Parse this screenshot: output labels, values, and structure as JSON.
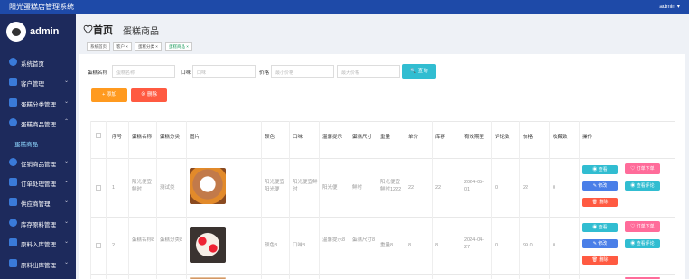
{
  "topbar": {
    "title": "阳光蛋糕店管理系统",
    "user": "admin ▾"
  },
  "sidebar": {
    "username": "admin",
    "items": [
      {
        "label": "系统首页",
        "arrow": ""
      },
      {
        "label": "客户管理",
        "arrow": "⌄"
      },
      {
        "label": "蛋糕分类管理",
        "arrow": "⌄"
      },
      {
        "label": "蛋糕商品管理",
        "arrow": "⌃"
      },
      {
        "label": "蛋糕商品",
        "arrow": ""
      },
      {
        "label": "促销商品管理",
        "arrow": "⌄"
      },
      {
        "label": "订单处理管理",
        "arrow": "⌄"
      },
      {
        "label": "供应商管理",
        "arrow": "⌄"
      },
      {
        "label": "库存原料管理",
        "arrow": "⌄"
      },
      {
        "label": "原料入库管理",
        "arrow": "⌄"
      },
      {
        "label": "原料出库管理",
        "arrow": "⌄"
      }
    ]
  },
  "header": {
    "home": "♡首页",
    "page": "蛋糕商品"
  },
  "crumbs": [
    "系统首页",
    "客户 ×",
    "蛋糕分类 ×",
    "蛋糕商品 ×"
  ],
  "search": {
    "name_label": "蛋糕名称",
    "name_placeholder": "蛋糕名称",
    "flavor_label": "口味",
    "flavor_placeholder": "口味",
    "price_label": "价格",
    "price_min_placeholder": "最小价格",
    "price_max_placeholder": "最大价格",
    "search_button": "🔍 查询"
  },
  "actions": {
    "add": "+ 添加",
    "delete": "⊗ 删除"
  },
  "table": {
    "headers": [
      "序号",
      "蛋糕名称",
      "蛋糕分类",
      "图片",
      "颜色",
      "口味",
      "温馨提示",
      "蛋糕尺寸",
      "重量",
      "单价",
      "库存",
      "有效期至",
      "评论数",
      "价格",
      "收藏数",
      "操作"
    ],
    "rows": [
      {
        "index": "1",
        "name": "阳光便宜鲜时",
        "category": "测试类",
        "color": "阳光便宜阳光便",
        "flavor": "阳光便宜鲜时",
        "tip": "阳光便",
        "size": "鲜时",
        "weight": "阳光便宜鲜时1222",
        "unit_price": "22",
        "stock": "22",
        "expiry": "2024-05-01",
        "comments": "0",
        "price": "22",
        "favorites": "0"
      },
      {
        "index": "2",
        "name": "蛋糕名称8",
        "category": "蛋糕分类8",
        "color": "颜色8",
        "flavor": "口味8",
        "tip": "温馨提示8",
        "size": "蛋糕尺寸8",
        "weight": "重量8",
        "unit_price": "8",
        "stock": "8",
        "expiry": "2024-04-27",
        "comments": "0",
        "price": "99.0",
        "favorites": "0"
      }
    ],
    "ops": {
      "view": "◉ 查看",
      "order": "♡ 订单下单",
      "edit": "✎ 修改",
      "review": "◉ 查看评论",
      "delete": "🗑 删除"
    }
  },
  "colors": {
    "topbar": "#1e4aa8",
    "sidebar": "#1d2a5c",
    "cyan": "#31bdd1",
    "pink": "#ff6c9a",
    "red": "#ff5a41",
    "orange": "#ff9a1f"
  }
}
